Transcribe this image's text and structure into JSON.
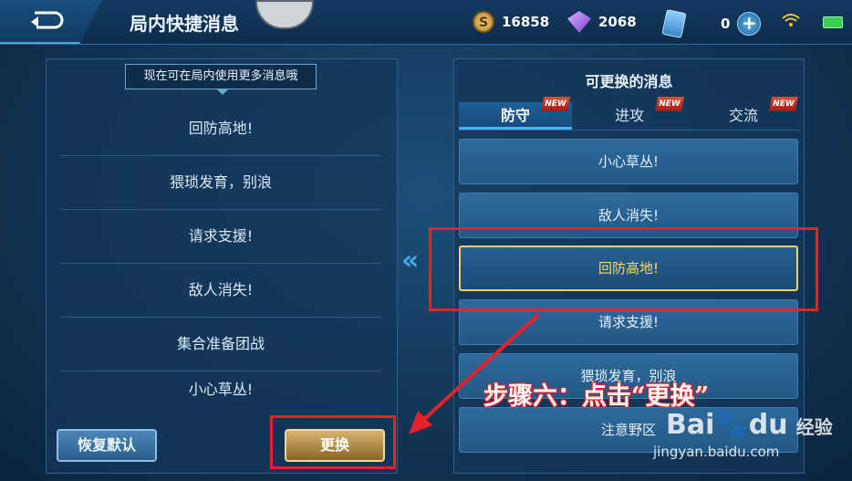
{
  "header": {
    "title": "局内快捷消息",
    "gold": "16858",
    "diamonds": "2068",
    "cards": "0",
    "coin_symbol": "S",
    "plus_symbol": "+"
  },
  "left_panel": {
    "tooltip": "现在可在局内使用更多消息哦",
    "messages": [
      "回防高地!",
      "猥琐发育，别浪",
      "请求支援!",
      "敌人消失!",
      "集合准备团战",
      "小心草丛!"
    ],
    "restore_button": "恢复默认",
    "replace_button": "更换"
  },
  "middle": {
    "arrow": "«"
  },
  "right_panel": {
    "title": "可更换的消息",
    "tabs": [
      {
        "label": "防守",
        "badge": "NEW"
      },
      {
        "label": "进攻",
        "badge": "NEW"
      },
      {
        "label": "交流",
        "badge": "NEW"
      }
    ],
    "options": [
      "小心草丛!",
      "敌人消失!",
      "回防高地!",
      "请求支援!",
      "猥琐发育，别浪",
      "注意野区"
    ]
  },
  "annotation": "步骤六：点击“更换”",
  "watermark": {
    "brand": "Bai",
    "brand2": "du",
    "product": "经验",
    "url": "jingyan.baidu.com"
  },
  "colors": {
    "highlight": "#e5222a",
    "selected_text": "#ffd866",
    "accent": "#4ab0ff"
  }
}
